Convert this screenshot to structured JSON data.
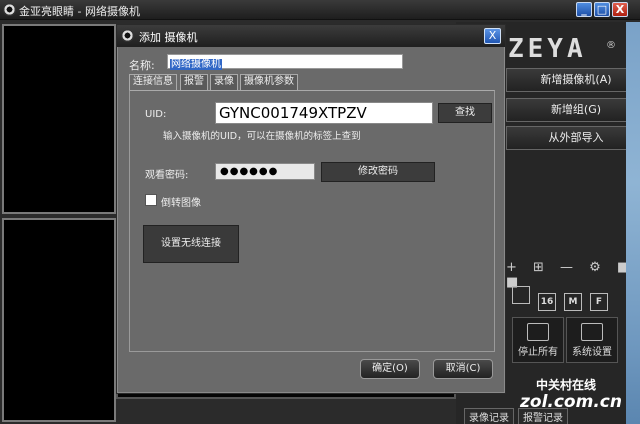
{
  "app": {
    "title": "金亚亮眼睛 - 网络摄像机",
    "window_buttons": {
      "minimize": "_",
      "maximize": "□",
      "close": "X"
    }
  },
  "right_panel": {
    "brand": "ZEYA",
    "brand_mark": "®",
    "add_camera": "新增摄像机(A)",
    "add_group": "新增组(G)",
    "import_external": "从外部导入",
    "toolbar_glyphs": "+ ⊞ — ⚙ ■ ■",
    "grid_icons": [
      "",
      "16",
      "M",
      "F"
    ],
    "stop_all": "停止所有",
    "system_settings": "系统设置",
    "bottom_left": "录像记录",
    "bottom_right": "报警记录"
  },
  "dialog": {
    "title": "添加 摄像机",
    "close": "X",
    "name_label": "名称:",
    "name_value": "网络摄像机",
    "tabs": [
      "连接信息",
      "报警",
      "录像",
      "摄像机参数"
    ],
    "active_tab": 0,
    "uid_label": "UID:",
    "uid_value": "GYNC001749XTPZV",
    "find_button": "查找",
    "uid_hint": "输入摄像机的UID，可以在摄像机的标签上查到",
    "password_label": "观看密码:",
    "password_value": "●●●●●●",
    "change_password_button": "修改密码",
    "flip_label": "倒转图像",
    "flip_checked": false,
    "wifi_button": "设置无线连接",
    "ok_button": "确定(O)",
    "cancel_button": "取消(C)"
  },
  "watermark": {
    "cn": "中关村在线",
    "en": "zol.com.cn"
  },
  "colors": {
    "dialog_bg": "#6a6a6a",
    "app_bg": "#2b2b2b",
    "selection": "#3167c6"
  }
}
